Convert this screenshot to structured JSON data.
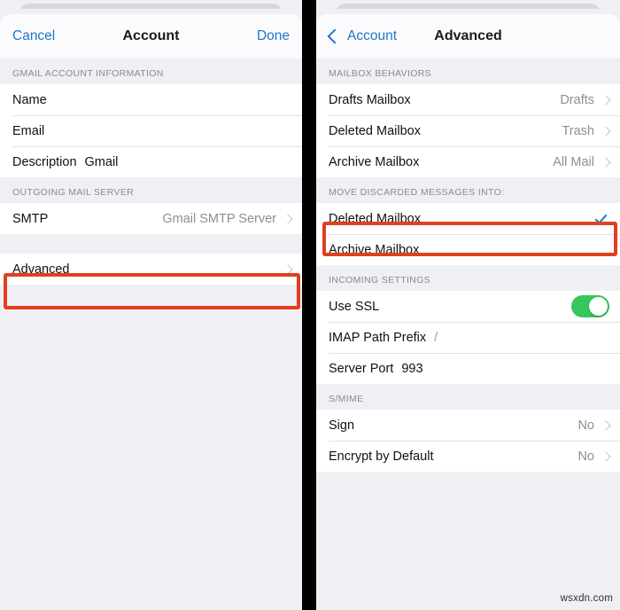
{
  "watermark": "wsxdn.com",
  "accent_colors": {
    "link_blue": "#2077c6",
    "toggle_green": "#35c759",
    "checkmark_blue": "#1b76c8",
    "annotation_red": "#e0401f",
    "background_gray": "#EFEFF4"
  },
  "left_screen": {
    "nav": {
      "cancel_label": "Cancel",
      "title": "Account",
      "done_label": "Done"
    },
    "sections": [
      {
        "header": "GMAIL ACCOUNT INFORMATION",
        "rows": [
          {
            "label": "Name",
            "inline_value": "",
            "value": "",
            "chevron": false
          },
          {
            "label": "Email",
            "inline_value": "",
            "value": "",
            "chevron": false
          },
          {
            "label": "Description",
            "inline_value": "Gmail",
            "value": "",
            "chevron": false
          }
        ]
      },
      {
        "header": "OUTGOING MAIL SERVER",
        "rows": [
          {
            "label": "SMTP",
            "inline_value": "",
            "value": "Gmail SMTP Server",
            "chevron": true
          }
        ]
      },
      {
        "header": "",
        "rows": [
          {
            "label": "Advanced",
            "inline_value": "",
            "value": "",
            "chevron": true
          }
        ]
      }
    ]
  },
  "right_screen": {
    "nav": {
      "back_label": "Account",
      "title": "Advanced"
    },
    "sections": [
      {
        "header": "MAILBOX BEHAVIORS",
        "rows": [
          {
            "label": "Drafts Mailbox",
            "value": "Drafts",
            "chevron": true
          },
          {
            "label": "Deleted Mailbox",
            "value": "Trash",
            "chevron": true
          },
          {
            "label": "Archive Mailbox",
            "value": "All Mail",
            "chevron": true
          }
        ]
      },
      {
        "header": "MOVE DISCARDED MESSAGES INTO:",
        "rows": [
          {
            "label": "Deleted Mailbox",
            "value": "",
            "chevron": false,
            "checked": true
          },
          {
            "label": "Archive Mailbox",
            "value": "",
            "chevron": false,
            "checked": false
          }
        ]
      },
      {
        "header": "INCOMING SETTINGS",
        "rows": [
          {
            "label": "Use SSL",
            "value": "",
            "chevron": false,
            "toggle": true,
            "toggle_on": true
          },
          {
            "label": "IMAP Path Prefix",
            "inline_value": "/",
            "value": "",
            "chevron": false
          },
          {
            "label": "Server Port",
            "inline_value": "993",
            "value": "",
            "chevron": false
          }
        ]
      },
      {
        "header": "S/MIME",
        "rows": [
          {
            "label": "Sign",
            "value": "No",
            "chevron": true
          },
          {
            "label": "Encrypt by Default",
            "value": "No",
            "chevron": true
          }
        ]
      }
    ]
  }
}
